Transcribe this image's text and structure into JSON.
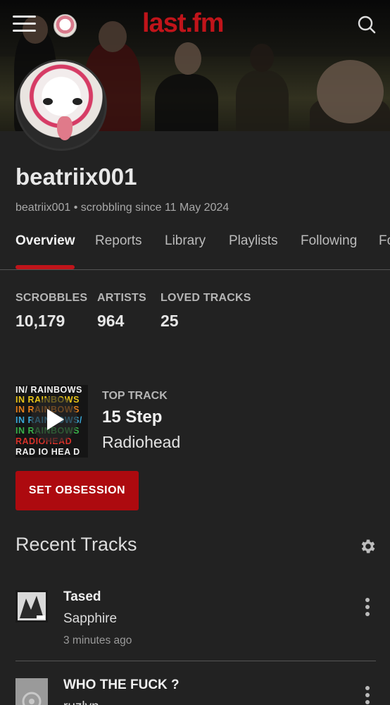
{
  "header": {
    "logo_text": "last.fm",
    "brand_color": "#c0141a"
  },
  "profile": {
    "username": "beatriix001",
    "subline": "beatriix001 • scrobbling since 11 May 2024"
  },
  "tabs": [
    {
      "label": "Overview",
      "active": true
    },
    {
      "label": "Reports"
    },
    {
      "label": "Library"
    },
    {
      "label": "Playlists"
    },
    {
      "label": "Following"
    },
    {
      "label": "Fo"
    }
  ],
  "stats": [
    {
      "label": "SCROBBLES",
      "value": "10,179"
    },
    {
      "label": "ARTISTS",
      "value": "964"
    },
    {
      "label": "LOVED TRACKS",
      "value": "25"
    }
  ],
  "top_track": {
    "label": "TOP TRACK",
    "title": "15 Step",
    "artist": "Radiohead",
    "album_art_text": [
      "IN/ RAINBOWS",
      "IN RAINBOWS",
      "IN RAINBOWS",
      "IN RAINBOWS/",
      "IN RAINBOWS",
      "RADIOHEAD",
      "RAD IO HEA D"
    ]
  },
  "obsession_button": "SET OBSESSION",
  "recent": {
    "title": "Recent Tracks",
    "tracks": [
      {
        "title": "Tased",
        "artist": "Sapphire",
        "time": "3 minutes ago"
      },
      {
        "title": "WHO THE FUCK ?",
        "artist": "ruzlvn"
      }
    ]
  }
}
